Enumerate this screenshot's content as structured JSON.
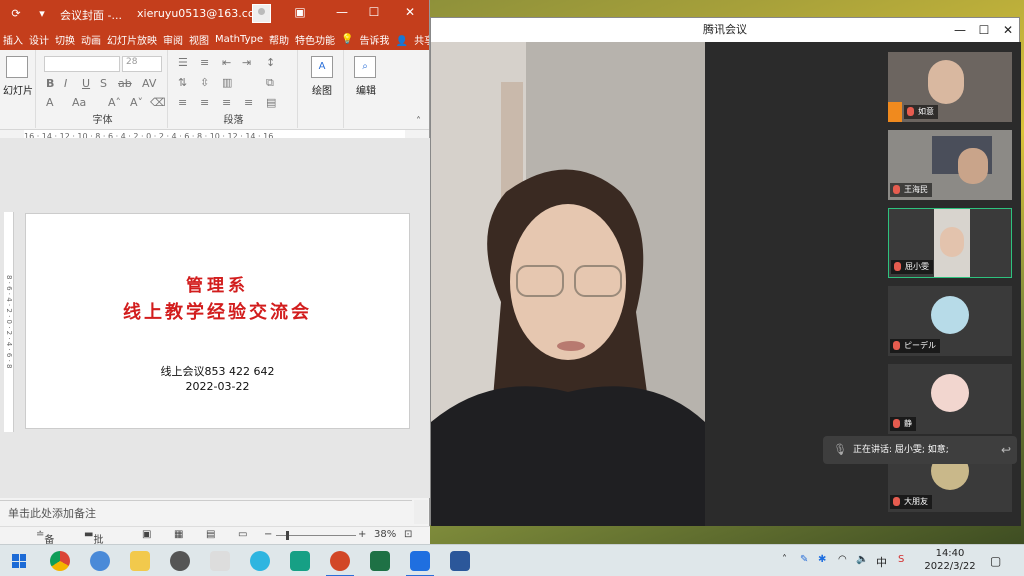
{
  "ppt": {
    "title_doc": "会议封面 -...",
    "account": "xieruyu0513@163.com",
    "menu": [
      "插入",
      "设计",
      "切换",
      "动画",
      "幻灯片放映",
      "审阅",
      "视图",
      "MathType",
      "帮助",
      "特色功能",
      "告诉我"
    ],
    "share": "共享",
    "ribbon": {
      "slides_label": "幻灯片",
      "font_size": "28",
      "font_group": "字体",
      "para_group": "段落",
      "draw_label": "绘图",
      "edit_label": "编辑"
    },
    "ruler_h": "16 · 14 · 12 · 10 · 8 · 6 · 4 · 2 · 0 · 2 · 4 · 6 · 8 · 10 · 12 · 14 · 16",
    "ruler_v": "8 · 6 · 4 · 2 · 0 · 2 · 4 · 6 · 8",
    "slide": {
      "title1": "管理系",
      "title2": "线上教学经验交流会",
      "line1": "线上会议853 422 642",
      "line2": "2022-03-22"
    },
    "notes_placeholder": "单击此处添加备注",
    "status": {
      "notes": "备注",
      "comments": "批注",
      "zoom": "38%"
    }
  },
  "meeting": {
    "title": "腾讯会议",
    "participants": [
      {
        "name": "如意"
      },
      {
        "name": "王海民"
      },
      {
        "name": "屈小雯"
      },
      {
        "name": "ピーデル"
      },
      {
        "name": "静"
      },
      {
        "name": "大朋友"
      }
    ],
    "speaking": "正在讲话: 屈小雯; 如意;"
  },
  "taskbar": {
    "ime": "中",
    "time": "14:40",
    "date": "2022/3/22"
  }
}
